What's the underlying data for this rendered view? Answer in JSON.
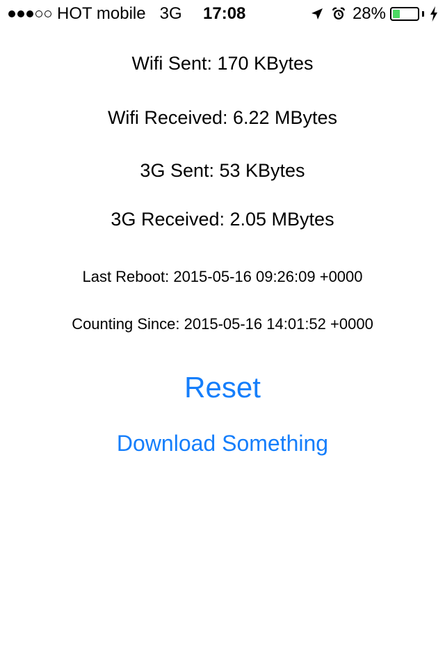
{
  "status_bar": {
    "signal": {
      "filled": 3,
      "total": 5
    },
    "carrier": "HOT mobile",
    "network": "3G",
    "time": "17:08",
    "battery_percent_text": "28%",
    "battery_level": 0.28,
    "battery_color": "#4cd964",
    "icons": [
      "location-arrow-icon",
      "alarm-clock-icon",
      "battery-icon",
      "charging-bolt-icon"
    ]
  },
  "stats": {
    "wifi_sent": "Wifi Sent: 170 KBytes",
    "wifi_received": "Wifi Received: 6.22 MBytes",
    "cell_sent": "3G Sent: 53 KBytes",
    "cell_received": "3G Received: 2.05 MBytes",
    "last_reboot": "Last Reboot: 2015-05-16 09:26:09 +0000",
    "counting_since": "Counting Since: 2015-05-16 14:01:52 +0000"
  },
  "actions": {
    "reset_label": "Reset",
    "download_label": "Download Something",
    "accent_color": "#157efb"
  }
}
